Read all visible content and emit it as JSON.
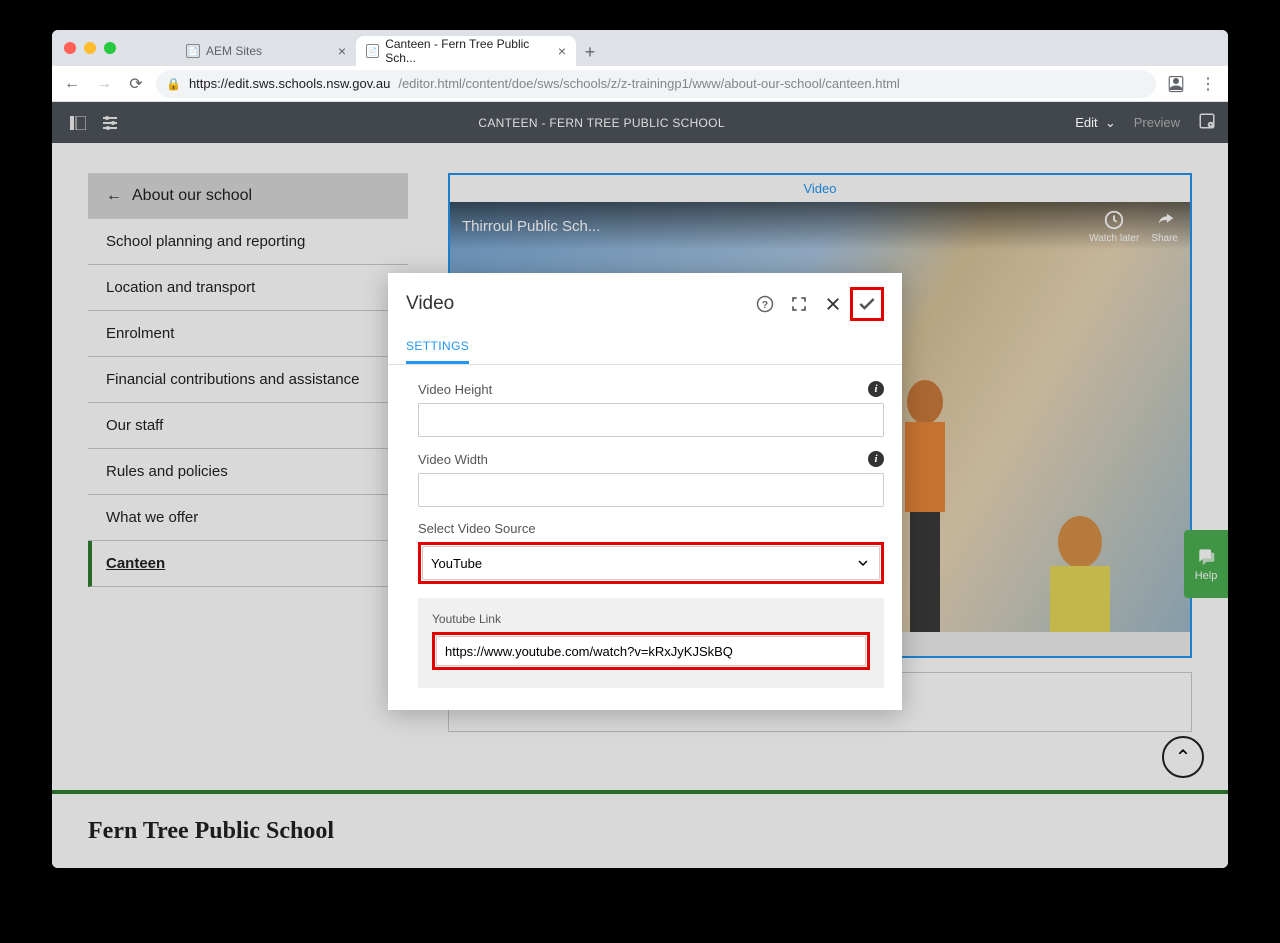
{
  "browser": {
    "tabs": [
      {
        "title": "AEM Sites",
        "active": false
      },
      {
        "title": "Canteen - Fern Tree Public Sch...",
        "active": true
      }
    ],
    "url_host": "https://edit.sws.schools.nsw.gov.au",
    "url_path": "/editor.html/content/doe/sws/schools/z/z-trainingp1/www/about-our-school/canteen.html"
  },
  "aem": {
    "title": "CANTEEN - FERN TREE PUBLIC SCHOOL",
    "edit": "Edit",
    "preview": "Preview"
  },
  "sidebar": {
    "back": "About our school",
    "items": [
      "School planning and reporting",
      "Location and transport",
      "Enrolment",
      "Financial contributions and assistance",
      "Our staff",
      "Rules and policies",
      "What we offer",
      "Canteen"
    ],
    "active_index": 7
  },
  "videobox": {
    "label": "Video",
    "yt_title": "Thirroul Public Sch...",
    "watch_later": "Watch later",
    "share": "Share"
  },
  "dialog": {
    "title": "Video",
    "tab": "SETTINGS",
    "height_label": "Video Height",
    "width_label": "Video Width",
    "source_label": "Select Video Source",
    "source_value": "YouTube",
    "link_label": "Youtube Link",
    "link_value": "https://www.youtube.com/watch?v=kRxJyKJSkBQ"
  },
  "footer": {
    "school": "Fern Tree Public School"
  },
  "help": "Help"
}
